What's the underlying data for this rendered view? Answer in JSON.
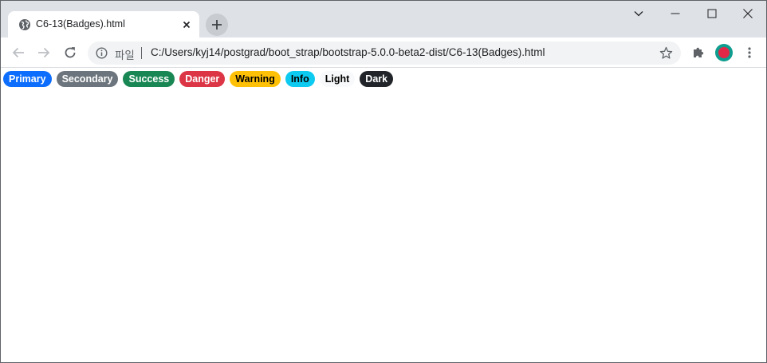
{
  "browser": {
    "tab": {
      "title": "C6-13(Badges).html",
      "favicon": "globe-icon",
      "close_icon": "close-icon"
    },
    "new_tab_icon": "plus-icon",
    "window_controls": [
      "chevron-down-icon",
      "minimize-icon",
      "maximize-icon",
      "close-icon"
    ],
    "nav": [
      "back-arrow-icon",
      "forward-arrow-icon",
      "reload-icon"
    ],
    "omnibox": {
      "security_icon": "info-icon",
      "scheme_label": "파일",
      "url": "C:/Users/kyj14/postgrad/boot_strap/bootstrap-5.0.0-beta2-dist/C6-13(Badges).html",
      "bookmark_icon": "star-icon"
    },
    "extensions_icon": "puzzle-icon",
    "profile_icon": "avatar",
    "menu_icon": "three-dot-menu-icon"
  },
  "page": {
    "badges": [
      {
        "label": "Primary",
        "bg": "#0d6efd",
        "fg": "#ffffff"
      },
      {
        "label": "Secondary",
        "bg": "#6c757d",
        "fg": "#ffffff"
      },
      {
        "label": "Success",
        "bg": "#198754",
        "fg": "#ffffff"
      },
      {
        "label": "Danger",
        "bg": "#dc3545",
        "fg": "#ffffff"
      },
      {
        "label": "Warning",
        "bg": "#ffc107",
        "fg": "#000000"
      },
      {
        "label": "Info",
        "bg": "#0dcaf0",
        "fg": "#000000"
      },
      {
        "label": "Light",
        "bg": "#f8f9fa",
        "fg": "#000000"
      },
      {
        "label": "Dark",
        "bg": "#212529",
        "fg": "#ffffff"
      }
    ]
  }
}
